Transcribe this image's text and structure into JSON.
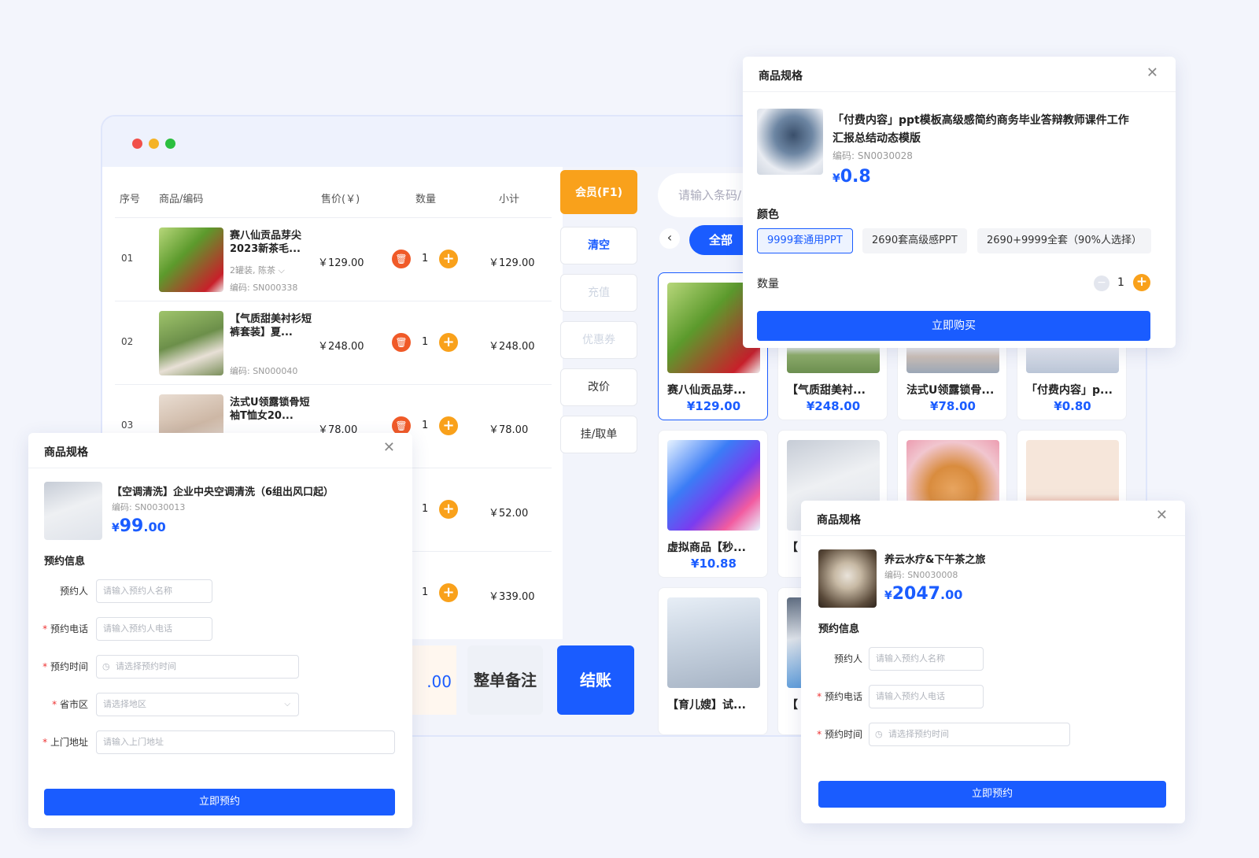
{
  "cart": {
    "headers": {
      "index": "序号",
      "product": "商品/编码",
      "price": "售价(￥)",
      "qty": "数量",
      "subtotal": "小计"
    },
    "rows": [
      {
        "index": "01",
        "name": "赛八仙贡品芽尖2023新茶毛...",
        "spec": "2罐装, 陈茶 ⌵",
        "code": "编码: SN000338",
        "price": "￥129.00",
        "qty": "1",
        "subtotal": "￥129.00"
      },
      {
        "index": "02",
        "name": "【气质甜美衬衫短裤套装】夏...",
        "spec": "",
        "code": "编码: SN000040",
        "price": "￥248.00",
        "qty": "1",
        "subtotal": "￥248.00"
      },
      {
        "index": "03",
        "name": "法式U领露锁骨短袖T恤女20...",
        "spec": "",
        "code": "",
        "price": "￥78.00",
        "qty": "1",
        "subtotal": "￥78.00"
      },
      {
        "index": "",
        "name": "",
        "spec": "",
        "code": "",
        "price": "",
        "qty": "1",
        "subtotal": "￥52.00"
      },
      {
        "index": "",
        "name": "",
        "spec": "",
        "code": "",
        "price": "",
        "qty": "1",
        "subtotal": "￥339.00"
      }
    ]
  },
  "side_buttons": {
    "member": "会员(F1)",
    "clear": "清空",
    "recharge": "充值",
    "coupon": "优惠券",
    "reprice": "改价",
    "hold": "挂/取单"
  },
  "bottom": {
    "amount": ".00",
    "note": "整单备注",
    "pay": "结账"
  },
  "product_area": {
    "search_placeholder": "请输入条码/",
    "category_all": "全部",
    "cards": [
      {
        "title": "赛八仙贡品芽...",
        "price": "¥129.00"
      },
      {
        "title": "【气质甜美衬...",
        "price": "¥248.00"
      },
      {
        "title": "法式U领露锁骨...",
        "price": "¥78.00"
      },
      {
        "title": "「付费内容」p...",
        "price": "¥0.80"
      },
      {
        "title": "虚拟商品【秒...",
        "price": "¥10.88"
      },
      {
        "title": "【",
        "price": ""
      },
      {
        "title": "",
        "price": ""
      },
      {
        "title": "",
        "price": ""
      },
      {
        "title": "【育儿嫂】试...",
        "price": ""
      },
      {
        "title": "【",
        "price": ""
      }
    ]
  },
  "modal_ppt": {
    "title": "商品规格",
    "name_line1": "「付费内容」ppt模板高级感简约商务毕业答辩教师课件工作",
    "name_line2": "汇报总结动态模版",
    "code": "编码: SN0030028",
    "price_cur": "¥",
    "price_int": "0.8",
    "color_label": "颜色",
    "options": [
      "9999套通用PPT",
      "2690套高级感PPT",
      "2690+9999全套（90%人选择）"
    ],
    "selected_option": "9999套通用PPT",
    "qty_label": "数量",
    "qty": "1",
    "buy_button": "立即购买"
  },
  "modal_ac": {
    "title": "商品规格",
    "name": "【空调清洗】企业中央空调清洗（6组出风口起）",
    "code": "编码: SN0030013",
    "price_cur": "¥",
    "price_int": "99",
    "price_dec": ".00",
    "section": "预约信息",
    "fields": [
      {
        "label": "预约人",
        "required": false,
        "placeholder": "请输入预约人名称"
      },
      {
        "label": "预约电话",
        "required": true,
        "placeholder": "请输入预约人电话"
      },
      {
        "label": "预约时间",
        "required": true,
        "placeholder": "请选择预约时间"
      },
      {
        "label": "省市区",
        "required": true,
        "placeholder": "请选择地区"
      },
      {
        "label": "上门地址",
        "required": true,
        "placeholder": "请输入上门地址"
      }
    ],
    "submit": "立即预约"
  },
  "modal_spa": {
    "title": "商品规格",
    "name": "养云水疗&下午茶之旅",
    "code": "编码: SN0030008",
    "price_cur": "¥",
    "price_int": "2047",
    "price_dec": ".00",
    "section": "预约信息",
    "fields": [
      {
        "label": "预约人",
        "required": false,
        "placeholder": "请输入预约人名称"
      },
      {
        "label": "预约电话",
        "required": true,
        "placeholder": "请输入预约人电话"
      },
      {
        "label": "预约时间",
        "required": true,
        "placeholder": "请选择预约时间"
      }
    ],
    "submit": "立即预约"
  },
  "colors": {
    "primary": "#1a5cff",
    "orange": "#f9a11b",
    "danger": "#f05a28"
  }
}
